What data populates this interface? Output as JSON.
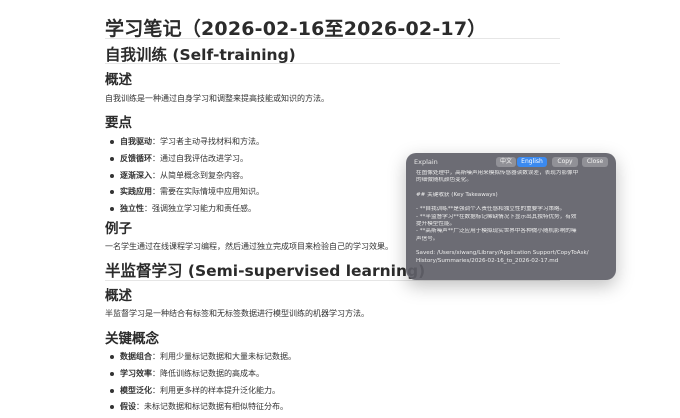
{
  "document": {
    "title": "学习笔记（2026-02-16至2026-02-17）",
    "sec1": {
      "heading": "自我训练 (Self-training)",
      "overview_heading": "概述",
      "overview_text": "自我训练是一种通过自身学习和调整来提高技能或知识的方法。",
      "points_heading": "要点",
      "points": [
        {
          "term": "自我驱动",
          "text": "：学习者主动寻找材料和方法。"
        },
        {
          "term": "反馈循环",
          "text": "：通过自我评估改进学习。"
        },
        {
          "term": "逐渐深入",
          "text": "：从简单概念到复杂内容。"
        },
        {
          "term": "实践应用",
          "text": "：需要在实际情境中应用知识。"
        },
        {
          "term": "独立性",
          "text": "：强调独立学习能力和责任感。"
        }
      ],
      "example_heading": "例子",
      "example_text": "一名学生通过在线课程学习编程，然后通过独立完成项目来检验自己的学习效果。"
    },
    "sec2": {
      "heading": "半监督学习 (Semi-supervised learning)",
      "overview_heading": "概述",
      "overview_text": "半监督学习是一种结合有标签和无标签数据进行模型训练的机器学习方法。",
      "concepts_heading": "关键概念",
      "concepts": [
        {
          "term": "数据组合",
          "text": "：利用少量标记数据和大量未标记数据。"
        },
        {
          "term": "学习效率",
          "text": "：降低训练标记数据的高成本。"
        },
        {
          "term": "模型泛化",
          "text": "：利用更多样的样本提升泛化能力。"
        },
        {
          "term": "假设",
          "text": "：未标记数据和标记数据有相似特征分布。"
        }
      ]
    }
  },
  "popup": {
    "title": "Explain",
    "buttons": {
      "zh": "中文",
      "en": "English",
      "copy": "Copy",
      "close": "Close"
    },
    "lines": [
      "在图像处理中，高斯噪声用来模拟传感器读数误差，表现为影像中",
      "的细微随机颜色变化。",
      "",
      "## 关键收获 (Key Takeaways)",
      "",
      "- **自我训练**是强调个人责任感和独立性的重要学习策略。",
      "- **半监督学习**在数据标记稀缺情况下显示出其独特优势，有效",
      "提升模型性能。",
      "- **高斯噪声**广泛应用于模拟现实世界中各种微小随机影响的噪",
      "声信号。",
      "",
      "Saved: /Users/xiwang/Library/Application Support/CopyToAsk/",
      "History/Summaries/2026-02-16_to_2026-02-17.md"
    ]
  }
}
